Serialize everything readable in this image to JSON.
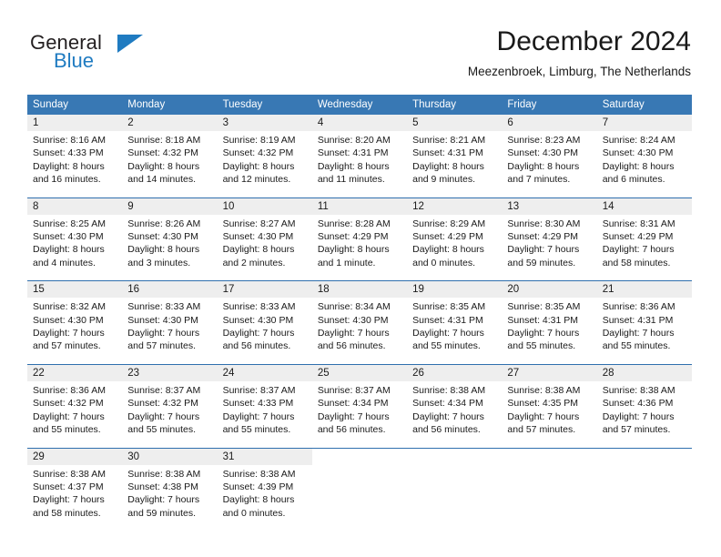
{
  "brand": {
    "name_part1": "General",
    "name_part2": "Blue",
    "accent_color": "#1f7bc1"
  },
  "header": {
    "title": "December 2024",
    "subtitle": "Meezenbroek, Limburg, The Netherlands"
  },
  "calendar": {
    "header_bg": "#3878b4",
    "daynum_bg": "#eeeeee",
    "rule_color": "#2f6fae",
    "weekday_headers": [
      "Sunday",
      "Monday",
      "Tuesday",
      "Wednesday",
      "Thursday",
      "Friday",
      "Saturday"
    ],
    "weeks": [
      [
        {
          "day": "1",
          "sunrise": "Sunrise: 8:16 AM",
          "sunset": "Sunset: 4:33 PM",
          "daylight_line1": "Daylight: 8 hours",
          "daylight_line2": "and 16 minutes."
        },
        {
          "day": "2",
          "sunrise": "Sunrise: 8:18 AM",
          "sunset": "Sunset: 4:32 PM",
          "daylight_line1": "Daylight: 8 hours",
          "daylight_line2": "and 14 minutes."
        },
        {
          "day": "3",
          "sunrise": "Sunrise: 8:19 AM",
          "sunset": "Sunset: 4:32 PM",
          "daylight_line1": "Daylight: 8 hours",
          "daylight_line2": "and 12 minutes."
        },
        {
          "day": "4",
          "sunrise": "Sunrise: 8:20 AM",
          "sunset": "Sunset: 4:31 PM",
          "daylight_line1": "Daylight: 8 hours",
          "daylight_line2": "and 11 minutes."
        },
        {
          "day": "5",
          "sunrise": "Sunrise: 8:21 AM",
          "sunset": "Sunset: 4:31 PM",
          "daylight_line1": "Daylight: 8 hours",
          "daylight_line2": "and 9 minutes."
        },
        {
          "day": "6",
          "sunrise": "Sunrise: 8:23 AM",
          "sunset": "Sunset: 4:30 PM",
          "daylight_line1": "Daylight: 8 hours",
          "daylight_line2": "and 7 minutes."
        },
        {
          "day": "7",
          "sunrise": "Sunrise: 8:24 AM",
          "sunset": "Sunset: 4:30 PM",
          "daylight_line1": "Daylight: 8 hours",
          "daylight_line2": "and 6 minutes."
        }
      ],
      [
        {
          "day": "8",
          "sunrise": "Sunrise: 8:25 AM",
          "sunset": "Sunset: 4:30 PM",
          "daylight_line1": "Daylight: 8 hours",
          "daylight_line2": "and 4 minutes."
        },
        {
          "day": "9",
          "sunrise": "Sunrise: 8:26 AM",
          "sunset": "Sunset: 4:30 PM",
          "daylight_line1": "Daylight: 8 hours",
          "daylight_line2": "and 3 minutes."
        },
        {
          "day": "10",
          "sunrise": "Sunrise: 8:27 AM",
          "sunset": "Sunset: 4:30 PM",
          "daylight_line1": "Daylight: 8 hours",
          "daylight_line2": "and 2 minutes."
        },
        {
          "day": "11",
          "sunrise": "Sunrise: 8:28 AM",
          "sunset": "Sunset: 4:29 PM",
          "daylight_line1": "Daylight: 8 hours",
          "daylight_line2": "and 1 minute."
        },
        {
          "day": "12",
          "sunrise": "Sunrise: 8:29 AM",
          "sunset": "Sunset: 4:29 PM",
          "daylight_line1": "Daylight: 8 hours",
          "daylight_line2": "and 0 minutes."
        },
        {
          "day": "13",
          "sunrise": "Sunrise: 8:30 AM",
          "sunset": "Sunset: 4:29 PM",
          "daylight_line1": "Daylight: 7 hours",
          "daylight_line2": "and 59 minutes."
        },
        {
          "day": "14",
          "sunrise": "Sunrise: 8:31 AM",
          "sunset": "Sunset: 4:29 PM",
          "daylight_line1": "Daylight: 7 hours",
          "daylight_line2": "and 58 minutes."
        }
      ],
      [
        {
          "day": "15",
          "sunrise": "Sunrise: 8:32 AM",
          "sunset": "Sunset: 4:30 PM",
          "daylight_line1": "Daylight: 7 hours",
          "daylight_line2": "and 57 minutes."
        },
        {
          "day": "16",
          "sunrise": "Sunrise: 8:33 AM",
          "sunset": "Sunset: 4:30 PM",
          "daylight_line1": "Daylight: 7 hours",
          "daylight_line2": "and 57 minutes."
        },
        {
          "day": "17",
          "sunrise": "Sunrise: 8:33 AM",
          "sunset": "Sunset: 4:30 PM",
          "daylight_line1": "Daylight: 7 hours",
          "daylight_line2": "and 56 minutes."
        },
        {
          "day": "18",
          "sunrise": "Sunrise: 8:34 AM",
          "sunset": "Sunset: 4:30 PM",
          "daylight_line1": "Daylight: 7 hours",
          "daylight_line2": "and 56 minutes."
        },
        {
          "day": "19",
          "sunrise": "Sunrise: 8:35 AM",
          "sunset": "Sunset: 4:31 PM",
          "daylight_line1": "Daylight: 7 hours",
          "daylight_line2": "and 55 minutes."
        },
        {
          "day": "20",
          "sunrise": "Sunrise: 8:35 AM",
          "sunset": "Sunset: 4:31 PM",
          "daylight_line1": "Daylight: 7 hours",
          "daylight_line2": "and 55 minutes."
        },
        {
          "day": "21",
          "sunrise": "Sunrise: 8:36 AM",
          "sunset": "Sunset: 4:31 PM",
          "daylight_line1": "Daylight: 7 hours",
          "daylight_line2": "and 55 minutes."
        }
      ],
      [
        {
          "day": "22",
          "sunrise": "Sunrise: 8:36 AM",
          "sunset": "Sunset: 4:32 PM",
          "daylight_line1": "Daylight: 7 hours",
          "daylight_line2": "and 55 minutes."
        },
        {
          "day": "23",
          "sunrise": "Sunrise: 8:37 AM",
          "sunset": "Sunset: 4:32 PM",
          "daylight_line1": "Daylight: 7 hours",
          "daylight_line2": "and 55 minutes."
        },
        {
          "day": "24",
          "sunrise": "Sunrise: 8:37 AM",
          "sunset": "Sunset: 4:33 PM",
          "daylight_line1": "Daylight: 7 hours",
          "daylight_line2": "and 55 minutes."
        },
        {
          "day": "25",
          "sunrise": "Sunrise: 8:37 AM",
          "sunset": "Sunset: 4:34 PM",
          "daylight_line1": "Daylight: 7 hours",
          "daylight_line2": "and 56 minutes."
        },
        {
          "day": "26",
          "sunrise": "Sunrise: 8:38 AM",
          "sunset": "Sunset: 4:34 PM",
          "daylight_line1": "Daylight: 7 hours",
          "daylight_line2": "and 56 minutes."
        },
        {
          "day": "27",
          "sunrise": "Sunrise: 8:38 AM",
          "sunset": "Sunset: 4:35 PM",
          "daylight_line1": "Daylight: 7 hours",
          "daylight_line2": "and 57 minutes."
        },
        {
          "day": "28",
          "sunrise": "Sunrise: 8:38 AM",
          "sunset": "Sunset: 4:36 PM",
          "daylight_line1": "Daylight: 7 hours",
          "daylight_line2": "and 57 minutes."
        }
      ],
      [
        {
          "day": "29",
          "sunrise": "Sunrise: 8:38 AM",
          "sunset": "Sunset: 4:37 PM",
          "daylight_line1": "Daylight: 7 hours",
          "daylight_line2": "and 58 minutes."
        },
        {
          "day": "30",
          "sunrise": "Sunrise: 8:38 AM",
          "sunset": "Sunset: 4:38 PM",
          "daylight_line1": "Daylight: 7 hours",
          "daylight_line2": "and 59 minutes."
        },
        {
          "day": "31",
          "sunrise": "Sunrise: 8:38 AM",
          "sunset": "Sunset: 4:39 PM",
          "daylight_line1": "Daylight: 8 hours",
          "daylight_line2": "and 0 minutes."
        },
        {
          "day": "",
          "sunrise": "",
          "sunset": "",
          "daylight_line1": "",
          "daylight_line2": ""
        },
        {
          "day": "",
          "sunrise": "",
          "sunset": "",
          "daylight_line1": "",
          "daylight_line2": ""
        },
        {
          "day": "",
          "sunrise": "",
          "sunset": "",
          "daylight_line1": "",
          "daylight_line2": ""
        },
        {
          "day": "",
          "sunrise": "",
          "sunset": "",
          "daylight_line1": "",
          "daylight_line2": ""
        }
      ]
    ]
  }
}
